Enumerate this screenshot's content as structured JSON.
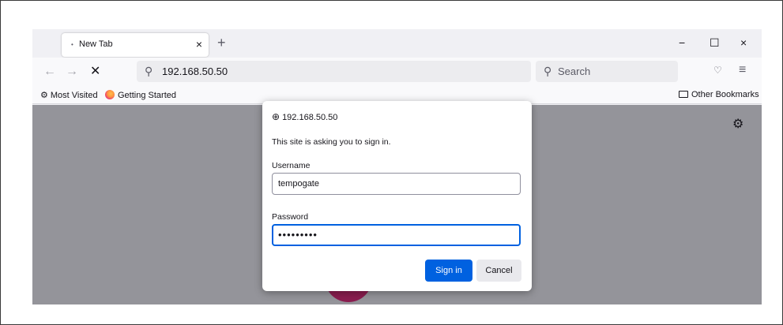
{
  "tab": {
    "title": "New Tab",
    "close": "×",
    "dot": "•"
  },
  "tabstrip": {
    "newtab": "+",
    "minimize": "−",
    "maximize": "☐",
    "close": "×"
  },
  "nav": {
    "back": "←",
    "forward": "→",
    "stop": "✕",
    "url": "192.168.50.50",
    "search_placeholder": "Search",
    "search_glyph": "⚲",
    "pocket": "♡",
    "menu": "≡"
  },
  "bookmarks": {
    "most_visited": "Most Visited",
    "getting_started": "Getting Started",
    "other_bookmarks": "Other Bookmarks"
  },
  "content": {
    "gear": "⚙"
  },
  "dialog": {
    "host": "192.168.50.50",
    "message": "This site is asking you to sign in.",
    "username_label": "Username",
    "username_value": "tempogate",
    "password_label": "Password",
    "password_value": "•••••••••",
    "sign_in": "Sign in",
    "cancel": "Cancel"
  },
  "colors": {
    "accent": "#0061e0",
    "overlay": "#94949a"
  }
}
